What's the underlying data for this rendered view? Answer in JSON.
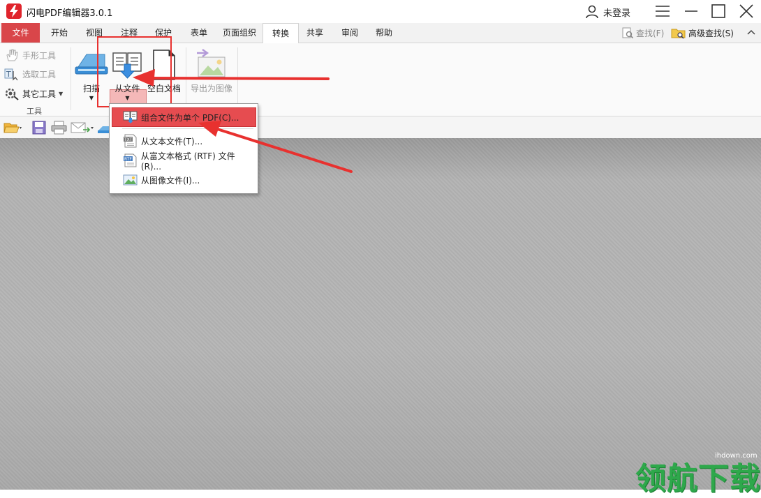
{
  "app": {
    "title": "闪电PDF编辑器3.0.1",
    "user": "未登录"
  },
  "tabs": [
    {
      "label": "文件"
    },
    {
      "label": "开始"
    },
    {
      "label": "视图"
    },
    {
      "label": "注释"
    },
    {
      "label": "保护"
    },
    {
      "label": "表单"
    },
    {
      "label": "页面组织"
    },
    {
      "label": "转换"
    },
    {
      "label": "共享"
    },
    {
      "label": "审阅"
    },
    {
      "label": "帮助"
    }
  ],
  "search": {
    "find_label": "查找(F)",
    "advanced_label": "高级查找(S)"
  },
  "ribbon": {
    "tools": [
      {
        "label": "手形工具"
      },
      {
        "label": "选取工具"
      },
      {
        "label": "其它工具"
      }
    ],
    "tools_group_label": "工具",
    "scan_label": "扫描",
    "from_file_label": "从文件",
    "blank_doc_label": "空白文档",
    "export_image_label": "导出为图像"
  },
  "menu": {
    "items": [
      {
        "label": "组合文件为单个 PDF(C)..."
      },
      {
        "label": "从文本文件(T)..."
      },
      {
        "label": "从富文本格式 (RTF) 文件(R)..."
      },
      {
        "label": "从图像文件(I)..."
      }
    ]
  },
  "watermark": {
    "site": "ihdown.com",
    "brand": "领航下载"
  },
  "colors": {
    "accent": "#d9464a",
    "annotation": "#e8312f",
    "watermark": "#2ea84b"
  }
}
